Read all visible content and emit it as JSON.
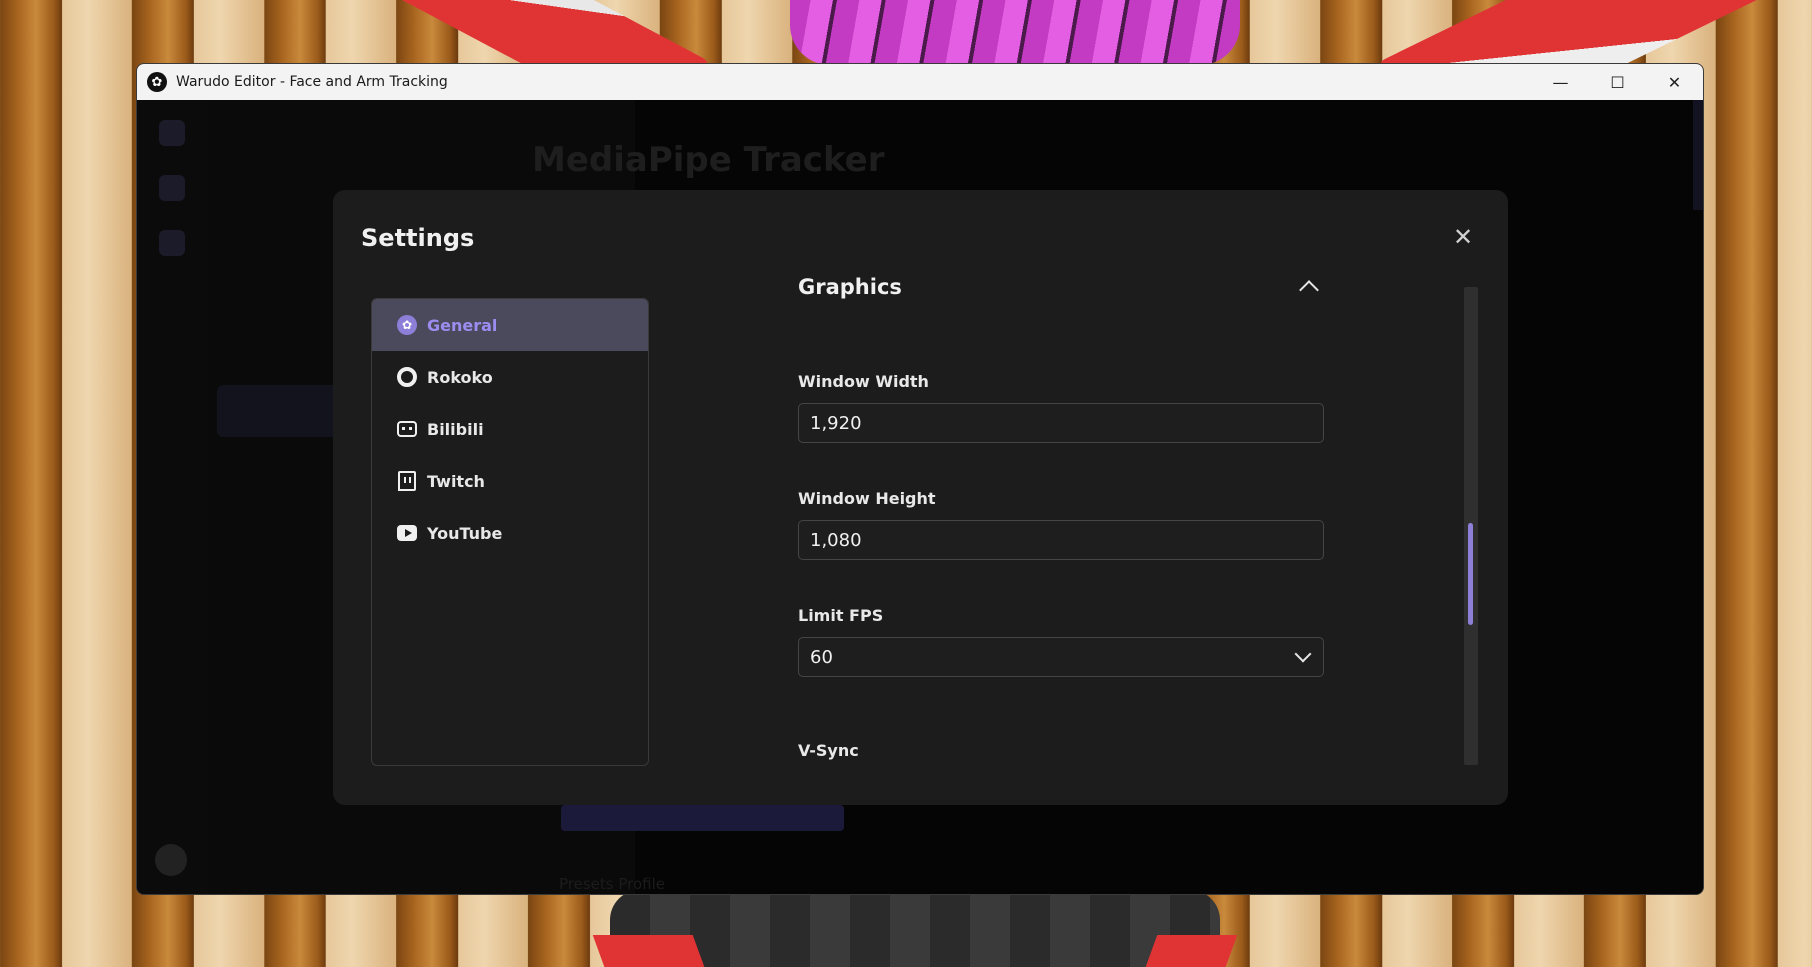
{
  "window": {
    "title": "Warudo Editor - Face and Arm Tracking",
    "controls": {
      "minimize": "—",
      "maximize": "☐",
      "close": "✕"
    }
  },
  "background": {
    "page_title": "MediaPipe Tracker",
    "footer_text": "Presets Profile"
  },
  "settings": {
    "title": "Settings",
    "close_glyph": "✕",
    "nav": [
      {
        "label": "General",
        "icon": "warudo-logo-icon",
        "active": true
      },
      {
        "label": "Rokoko",
        "icon": "ring-icon",
        "active": false
      },
      {
        "label": "Bilibili",
        "icon": "bilibili-tv-icon",
        "active": false
      },
      {
        "label": "Twitch",
        "icon": "twitch-icon",
        "active": false
      },
      {
        "label": "YouTube",
        "icon": "youtube-icon",
        "active": false
      }
    ],
    "section": {
      "title": "Graphics",
      "collapse_icon": "chevron-up-icon"
    },
    "fields": {
      "window_width": {
        "label": "Window Width",
        "value": "1,920"
      },
      "window_height": {
        "label": "Window Height",
        "value": "1,080"
      },
      "limit_fps": {
        "label": "Limit FPS",
        "value": "60"
      },
      "vsync": {
        "label": "V-Sync"
      }
    },
    "scroll_position": 0.55
  },
  "colors": {
    "accent": "#8d7fd8",
    "active_nav_bg": "#4b4a5c",
    "modal_bg": "#1c1c1c"
  }
}
